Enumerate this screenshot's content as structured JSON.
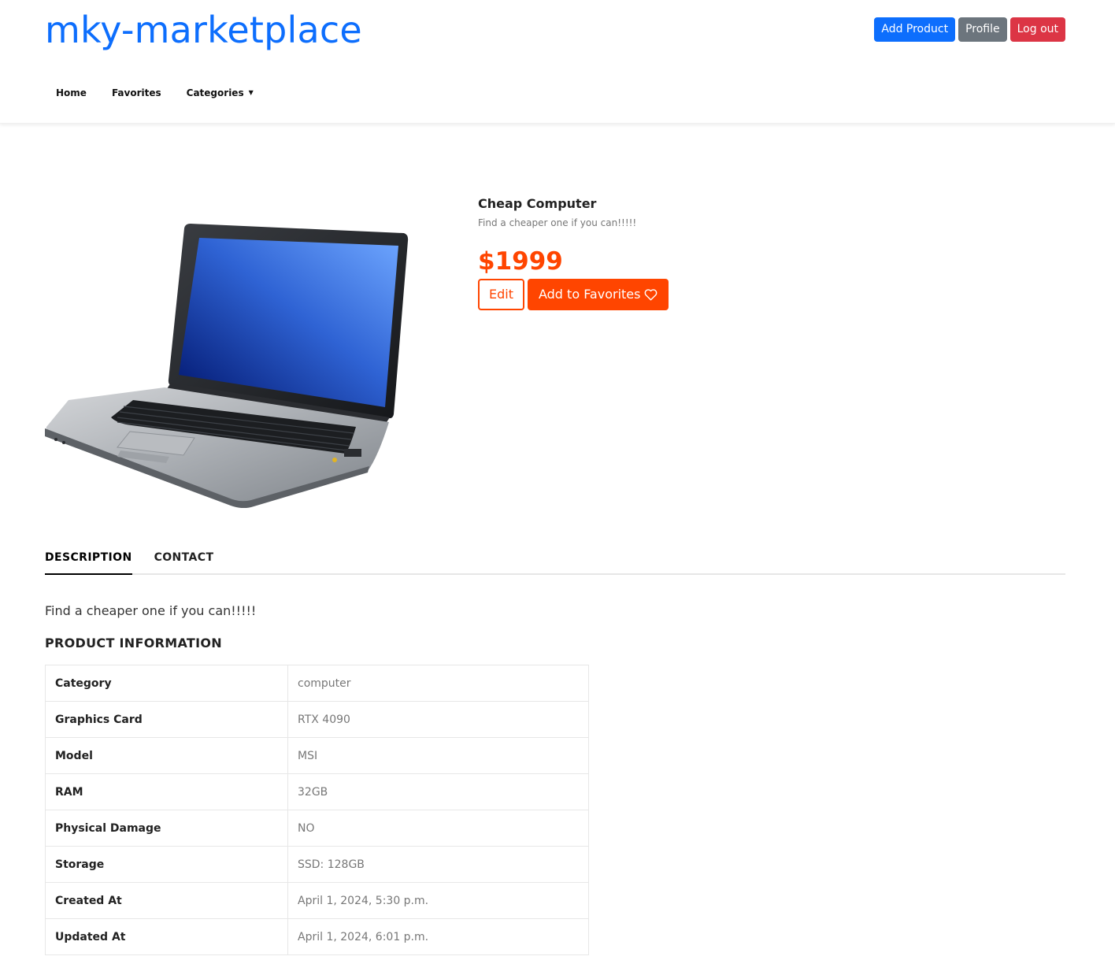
{
  "header": {
    "brand": "mky-marketplace",
    "buttons": {
      "add_product": "Add Product",
      "profile": "Profile",
      "logout": "Log out"
    },
    "nav": {
      "home": "Home",
      "favorites": "Favorites",
      "categories": "Categories"
    }
  },
  "product": {
    "title": "Cheap Computer",
    "subtitle": "Find a cheaper one if you can!!!!!",
    "price": "$1999",
    "edit_label": "Edit",
    "favorite_label": "Add to Favorites"
  },
  "tabs": {
    "description": "DESCRIPTION",
    "contact": "CONTACT"
  },
  "description": "Find a cheaper one if you can!!!!!",
  "info_heading": "PRODUCT INFORMATION",
  "info_rows": [
    {
      "key": "Category",
      "value": "computer"
    },
    {
      "key": "Graphics Card",
      "value": "RTX 4090"
    },
    {
      "key": "Model",
      "value": "MSI"
    },
    {
      "key": "RAM",
      "value": "32GB"
    },
    {
      "key": "Physical Damage",
      "value": "NO"
    },
    {
      "key": "Storage",
      "value": "SSD: 128GB"
    },
    {
      "key": "Created At",
      "value": "April 1, 2024, 5:30 p.m."
    },
    {
      "key": "Updated At",
      "value": "April 1, 2024, 6:01 p.m."
    }
  ],
  "colors": {
    "brand": "#0d6efd",
    "accent": "#ff4500",
    "danger": "#dc3545",
    "secondary": "#6c757d"
  },
  "icons": {
    "favorite": "heart-outline-icon",
    "categories": "chevron-down-icon"
  }
}
